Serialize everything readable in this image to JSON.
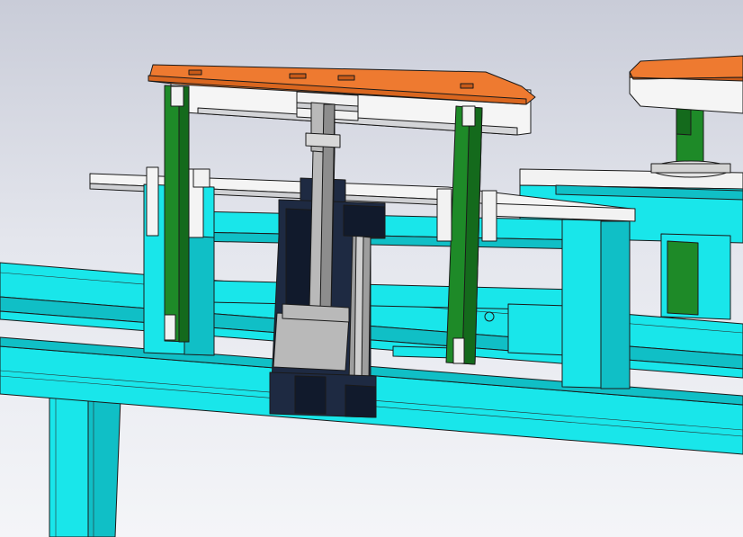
{
  "viewport": {
    "label": ""
  },
  "colors": {
    "frame": "#19e6ea",
    "frame_shade": "#10bfc6",
    "frame_dark": "#0a9aa4",
    "guide_rod": "#1e8a28",
    "guide_rod_dark": "#146a1c",
    "top_plate": "#ee7a30",
    "top_plate_dark": "#c85a18",
    "plate": "#f4f4f4",
    "plate_shade": "#cfd0d3",
    "cylinder_body": "#1e2a42",
    "cylinder_dark": "#111a2c",
    "piston_rod": "#b9b9b9",
    "piston_dark": "#8d8d8d",
    "background_top": "#c9ccd8",
    "background_bottom": "#f4f5f8"
  },
  "components": [
    {
      "name": "top-pressing-plate",
      "material": "orange"
    },
    {
      "name": "left-guide-rod",
      "material": "green"
    },
    {
      "name": "right-guide-rod",
      "material": "green"
    },
    {
      "name": "air-cylinder",
      "material": "navy"
    },
    {
      "name": "piston-rod",
      "material": "grey"
    },
    {
      "name": "mounting-plate",
      "material": "white"
    },
    {
      "name": "base-frame",
      "material": "cyan"
    },
    {
      "name": "adjacent-station",
      "material": "mixed"
    }
  ]
}
